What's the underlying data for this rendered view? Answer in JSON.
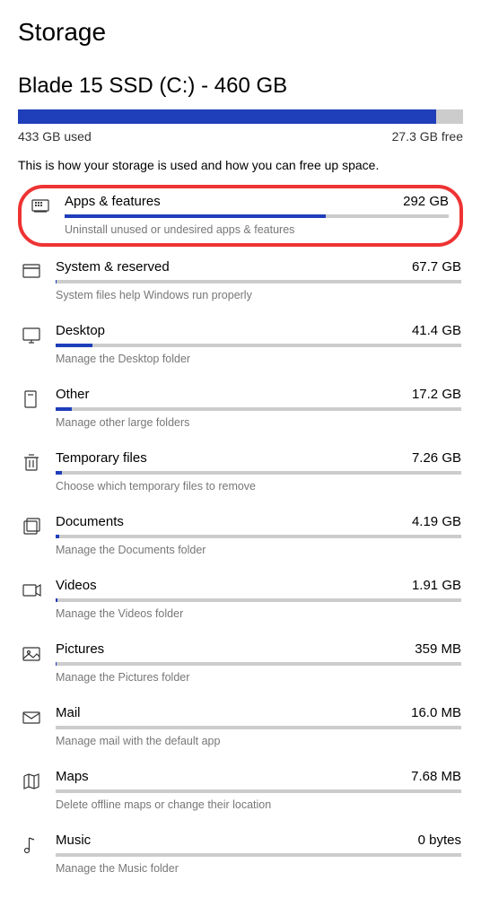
{
  "page_title": "Storage",
  "drive_title": "Blade 15 SSD (C:) - 460 GB",
  "used_label": "433 GB used",
  "free_label": "27.3 GB free",
  "overall_percent": 94,
  "description": "This is how your storage is used and how you can free up space.",
  "items": [
    {
      "name": "Apps & features",
      "size": "292 GB",
      "caption": "Uninstall unused or undesired apps & features",
      "percent": 68,
      "icon": "apps",
      "highlighted": true
    },
    {
      "name": "System & reserved",
      "size": "67.7 GB",
      "caption": "System files help Windows run properly",
      "percent": 0.2,
      "icon": "system"
    },
    {
      "name": "Desktop",
      "size": "41.4 GB",
      "caption": "Manage the Desktop folder",
      "percent": 9,
      "icon": "desktop"
    },
    {
      "name": "Other",
      "size": "17.2 GB",
      "caption": "Manage other large folders",
      "percent": 4,
      "icon": "other"
    },
    {
      "name": "Temporary files",
      "size": "7.26 GB",
      "caption": "Choose which temporary files to remove",
      "percent": 1.6,
      "icon": "trash"
    },
    {
      "name": "Documents",
      "size": "4.19 GB",
      "caption": "Manage the Documents folder",
      "percent": 0.9,
      "icon": "documents"
    },
    {
      "name": "Videos",
      "size": "1.91 GB",
      "caption": "Manage the Videos folder",
      "percent": 0.4,
      "icon": "videos"
    },
    {
      "name": "Pictures",
      "size": "359 MB",
      "caption": "Manage the Pictures folder",
      "percent": 0.1,
      "icon": "pictures"
    },
    {
      "name": "Mail",
      "size": "16.0 MB",
      "caption": "Manage mail with the default app",
      "percent": 0,
      "icon": "mail"
    },
    {
      "name": "Maps",
      "size": "7.68 MB",
      "caption": "Delete offline maps or change their location",
      "percent": 0,
      "icon": "maps"
    },
    {
      "name": "Music",
      "size": "0 bytes",
      "caption": "Manage the Music folder",
      "percent": 0,
      "icon": "music"
    }
  ]
}
